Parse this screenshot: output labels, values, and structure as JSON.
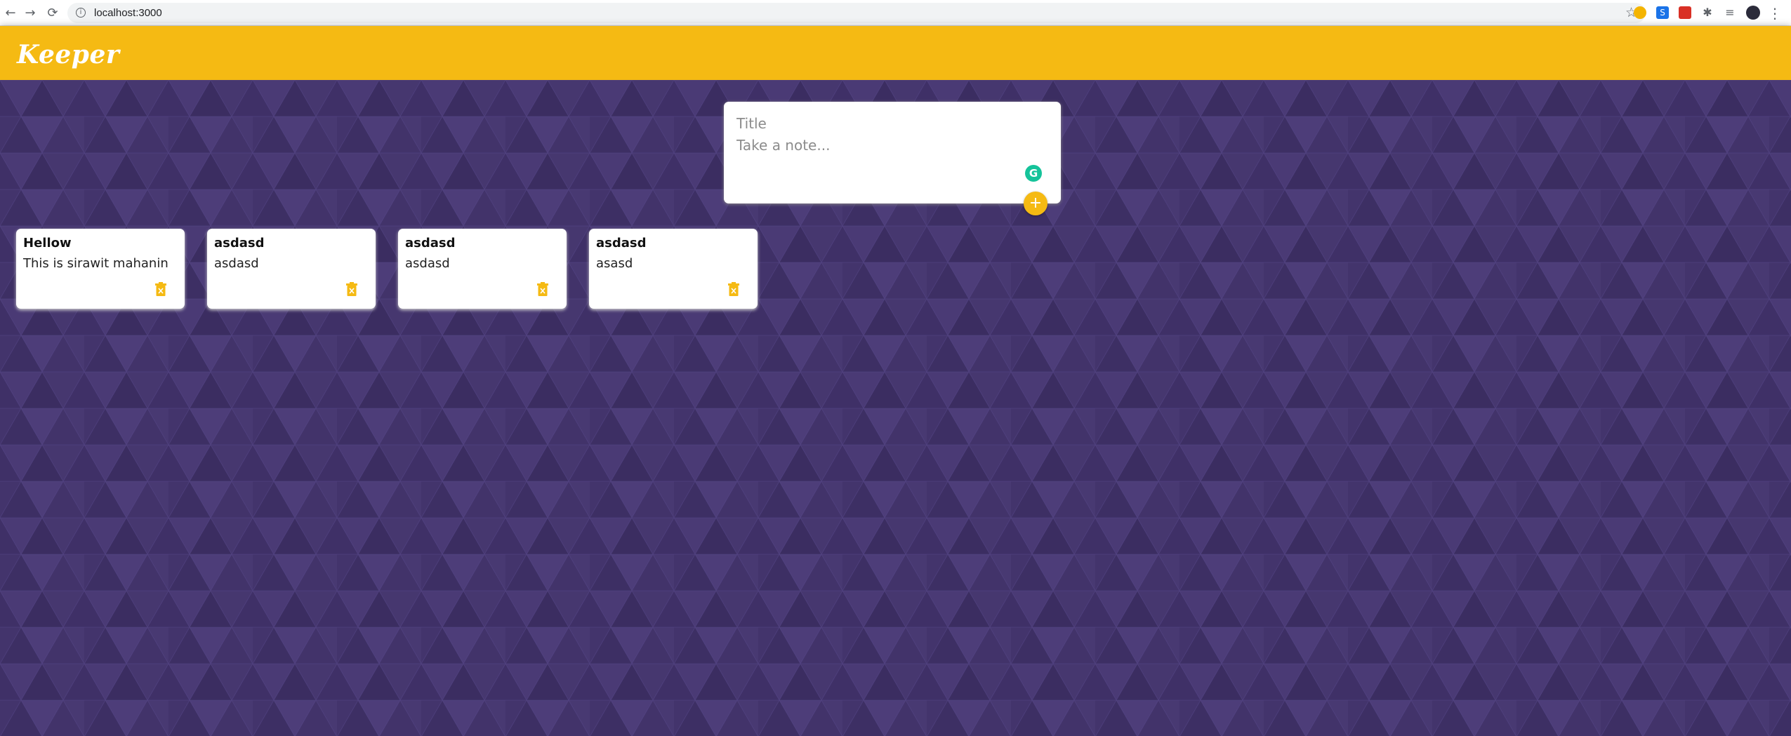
{
  "browser": {
    "back_icon": "←",
    "forward_icon": "→",
    "reload_icon": "⟳",
    "url": "localhost:3000",
    "menu_icon": "⋮"
  },
  "header": {
    "title": "Keeper",
    "color": "#f5ba13"
  },
  "create_area": {
    "title_placeholder": "Title",
    "content_placeholder": "Take a note...",
    "add_icon": "+"
  },
  "notes": [
    {
      "title": "Hellow",
      "content": "This is sirawit mahanin"
    },
    {
      "title": "asdasd",
      "content": "asdasd"
    },
    {
      "title": "asdasd",
      "content": "asdasd"
    },
    {
      "title": "asdasd",
      "content": "asasd"
    }
  ],
  "colors": {
    "background": "#3f3067",
    "accent": "#f5ba13",
    "grammarly": "#15c39a"
  }
}
